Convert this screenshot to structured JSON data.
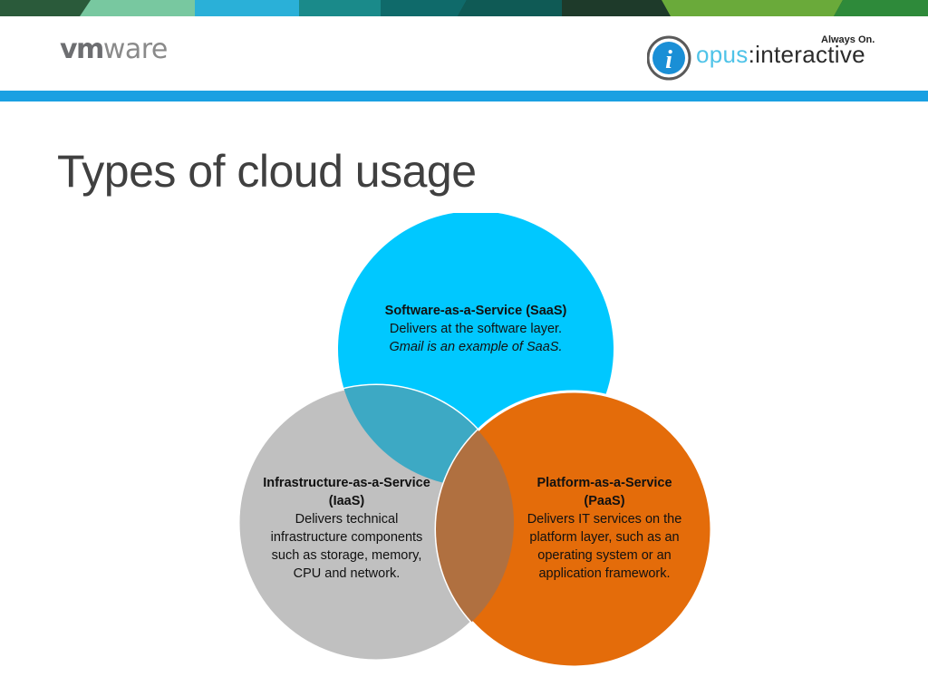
{
  "header": {
    "vmware_logo": {
      "part1": "vm",
      "part2": "ware"
    },
    "partner_logo": {
      "tagline": "Always On.",
      "word1": "opus",
      "separator": ":",
      "word2": "interactive",
      "glyph": "i"
    }
  },
  "slide": {
    "title": "Types of cloud usage"
  },
  "venn": {
    "saas": {
      "heading": "Software-as-a-Service (SaaS)",
      "description": "Delivers at the software layer.",
      "example": "Gmail is an example of SaaS.",
      "color": "#00c8ff"
    },
    "iaas": {
      "heading": "Infrastructure-as-a-Service (IaaS)",
      "description": "Delivers technical infrastructure components such as storage, memory, CPU and network.",
      "color": "#c0c0c0"
    },
    "paas": {
      "heading": "Platform-as-a-Service (PaaS)",
      "description": "Delivers IT services on the platform layer, such as an operating system or an application framework.",
      "color": "#e46c0a"
    },
    "overlap_colors": {
      "saas_iaas": "#3da9c4",
      "iaas_paas": "#b07040"
    }
  },
  "top_band_colors": [
    "#78c8a0",
    "#2ab0d8",
    "#1a8a8a",
    "#0f5a55",
    "#1e3a2a",
    "#6aaa3a",
    "#2e8a3a"
  ]
}
